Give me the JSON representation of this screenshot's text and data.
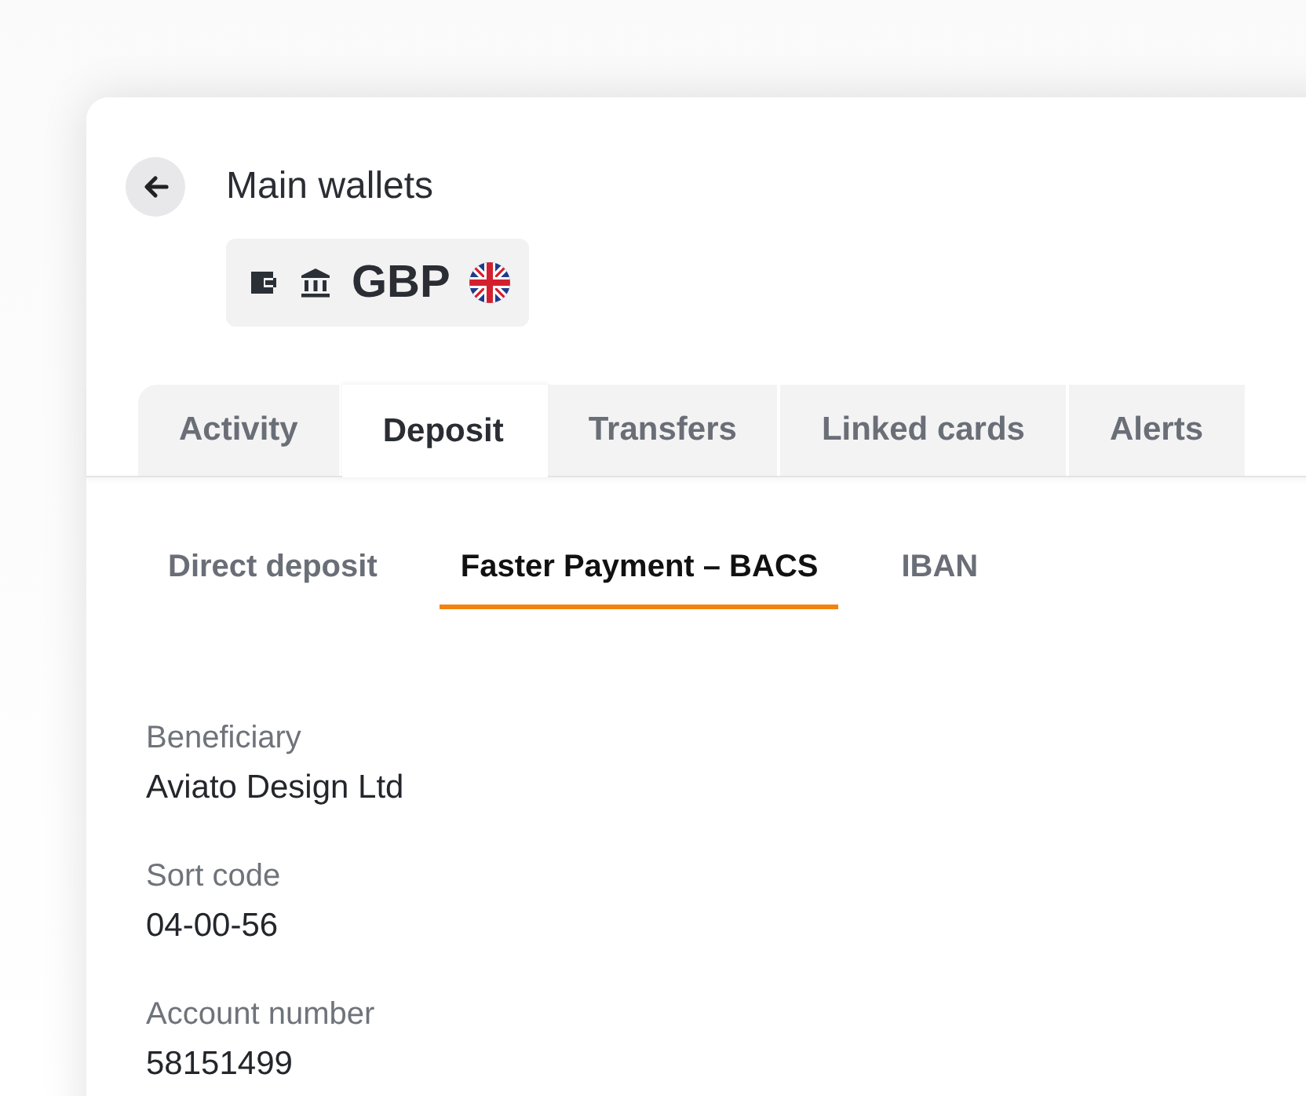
{
  "header": {
    "title": "Main wallets",
    "currency": "GBP"
  },
  "tabs": [
    {
      "label": "Activity",
      "selected": false
    },
    {
      "label": "Deposit",
      "selected": true
    },
    {
      "label": "Transfers",
      "selected": false
    },
    {
      "label": "Linked cards",
      "selected": false
    },
    {
      "label": "Alerts",
      "selected": false
    }
  ],
  "subtabs": [
    {
      "label": "Direct deposit",
      "selected": false
    },
    {
      "label": "Faster Payment – BACS",
      "selected": true
    },
    {
      "label": "IBAN",
      "selected": false
    }
  ],
  "fields": [
    {
      "label": "Beneficiary",
      "value": "Aviato Design Ltd"
    },
    {
      "label": "Sort code",
      "value": "04-00-56"
    },
    {
      "label": "Account number",
      "value": "58151499"
    }
  ]
}
